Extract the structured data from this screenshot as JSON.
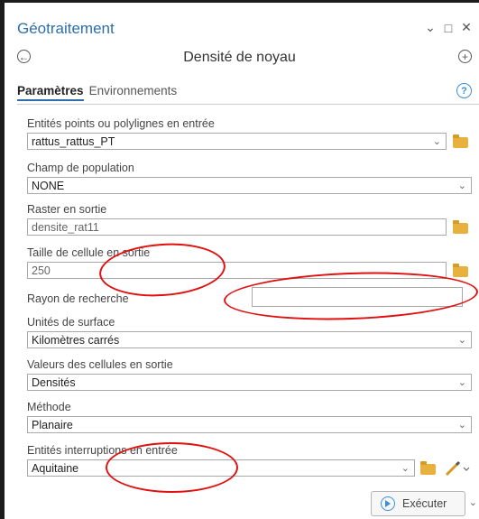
{
  "window": {
    "title": "Géotraitement",
    "buttons": {
      "dropdown": "⌄",
      "restore": "□",
      "close": "✕"
    }
  },
  "tool": {
    "title": "Densité de noyau",
    "back_icon": "←",
    "add_icon": "+"
  },
  "tabs": [
    {
      "label": "Paramètres",
      "active": true
    },
    {
      "label": "Environnements",
      "active": false
    }
  ],
  "help_icon": "?",
  "params": {
    "input_features": {
      "label": "Entités points ou polylignes en entrée",
      "value": "rattus_rattus_PT"
    },
    "population_field": {
      "label": "Champ de population",
      "value": "NONE"
    },
    "output_raster": {
      "label": "Raster en sortie",
      "value": "densite_rat11"
    },
    "cell_size": {
      "label": "Taille de cellule en sortie",
      "value": "250"
    },
    "search_radius": {
      "label": "Rayon de recherche",
      "value": ""
    },
    "area_units": {
      "label": "Unités de surface",
      "value": "Kilomètres carrés"
    },
    "output_values": {
      "label": "Valeurs des cellules en sortie",
      "value": "Densités"
    },
    "method": {
      "label": "Méthode",
      "value": "Planaire"
    },
    "barriers": {
      "label": "Entités interruptions en entrée",
      "value": "Aquitaine"
    }
  },
  "run_button": {
    "label": "Exécuter"
  },
  "annotation_color": "#e01010",
  "accent_color": "#2d6fa8"
}
